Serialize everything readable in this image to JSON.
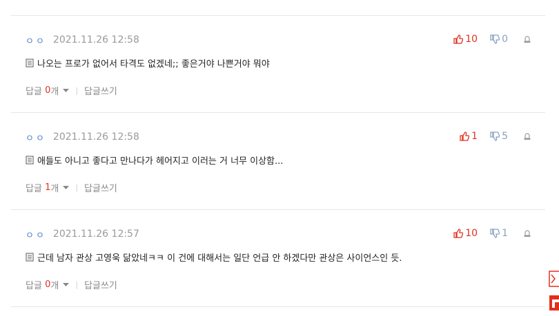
{
  "comments": [
    {
      "nickname": "ㅇㅇ",
      "date": "2021.11.26 12:58",
      "upvotes": "10",
      "downvotes": "0",
      "text": "나오는 프로가 없어서 타격도 없겠네;; 좋은거야 나쁜거야 뭐야",
      "reply_label": "답글",
      "reply_count": "0",
      "reply_unit": "개",
      "write_reply": "답글쓰기"
    },
    {
      "nickname": "ㅇㅇ",
      "date": "2021.11.26 12:58",
      "upvotes": "1",
      "downvotes": "5",
      "text": "애들도 아니고 좋다고 만나다가 헤어지고 이러는 거 너무 이상함...",
      "reply_label": "답글",
      "reply_count": "1",
      "reply_unit": "개",
      "write_reply": "답글쓰기"
    },
    {
      "nickname": "ㅇㅇ",
      "date": "2021.11.26 12:57",
      "upvotes": "10",
      "downvotes": "1",
      "text": "근데 남자 관상 고영욱 닮았네ㅋㅋ 이 건에 대해서는 일단 언급 안 하겠다만 관상은 사이언스인 듯.",
      "reply_label": "답글",
      "reply_count": "0",
      "reply_unit": "개",
      "write_reply": "답글쓰기"
    }
  ],
  "colors": {
    "upvote": "#e0301e",
    "downvote": "#8aa0c0",
    "nickname": "#4a7ec2",
    "divider": "#e6e6e6"
  },
  "icons": [
    "thumbs-up-icon",
    "thumbs-down-icon",
    "report-icon",
    "memo-icon",
    "caret-down-icon",
    "side-bookmark-icon",
    "side-red-icon"
  ]
}
